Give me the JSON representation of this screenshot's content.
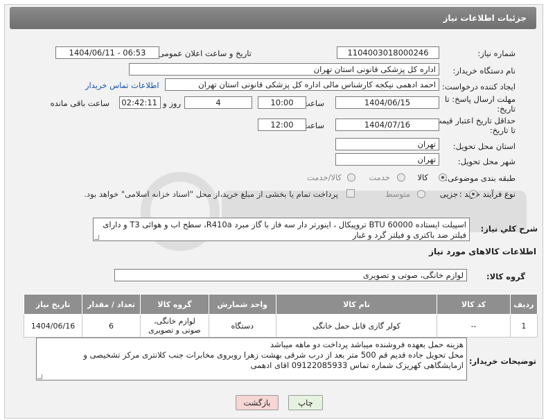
{
  "page_title": "جزئیات اطلاعات نیاز",
  "fields": {
    "need_number_label": "شماره نیاز:",
    "need_number": "1104003018000246",
    "announce_label": "تاریخ و ساعت اعلان عمومی:",
    "announce_value": "1404/06/11 - 06:53",
    "buyer_org_label": "نام دستگاه خریدار:",
    "buyer_org": "اداره کل پزشکی قانونی استان تهران",
    "creator_label": "ایجاد کننده درخواست:",
    "creator": "احمد ادهمی نیکجه کارشناس مالی اداره کل پزشکی قانونی استان تهران",
    "buyer_contact_link": "اطلاعات تماس خریدار",
    "deadline_label_1": "مهلت ارسال پاسخ: تا",
    "deadline_label_2": "تاریخ:",
    "deadline_date": "1404/06/15",
    "time_label": "ساعت",
    "deadline_time": "10:00",
    "days_value": "4",
    "days_label": "روز و",
    "remaining_time": "02:42:11",
    "remaining_label": "ساعت باقی مانده",
    "validity_label_1": "حداقل تاریخ اعتبار قیمت:",
    "validity_label_2": "تا تاریخ:",
    "validity_date": "1404/07/16",
    "validity_time_label": "ساعت",
    "validity_time": "12:00",
    "province_label": "استان محل تحویل:",
    "province": "تهران",
    "city_label": "شهر محل تحویل:",
    "city": "تهران",
    "category_label": "طبقه بندی موضوعی:",
    "category_options": [
      "کالا",
      "خدمت",
      "کالا/خدمت"
    ],
    "process_label": "نوع فرآیند خرید :",
    "process_options": [
      "جزیی",
      "متوسط"
    ],
    "payment_note": "پرداخت تمام یا بخشی از مبلغ خرید،از محل \"اسناد خزانه اسلامی\" خواهد بود."
  },
  "description": {
    "label": "شرح كلي نياز:",
    "text": "اسپیلت ایستاده BTU 60000 تروپیکال ، اینورتر دار سه فاز با گاز مبرد R410a، سطح اب و هوائی T3 و دارای فیلتر ضد باکتری و فیلتر گرد و غبار"
  },
  "goods_section_title": "اطلاعات کالاهای مورد نیاز",
  "goods_group": {
    "label": "گروه کالا:",
    "value": "لوازم خانگی، صوتی و تصویری"
  },
  "table": {
    "headers": [
      "ردیف",
      "کد کالا",
      "نام کالا",
      "واحد شمارش",
      "گروه کالا",
      "تعداد / مقدار",
      "تاریخ نیاز"
    ],
    "rows": [
      {
        "row": "1",
        "code": "--",
        "name": "کولر گازی قابل حمل خانگی",
        "unit": "دستگاه",
        "group_line1": "لوازم خانگی،",
        "group_line2": "صوتی و تصویری",
        "qty": "6",
        "date": "1404/06/16"
      }
    ]
  },
  "buyer_notes": {
    "label": "توضیحات خریدار:",
    "lines": [
      "هزینه حمل بعهده فروشنده میباشد پرداخت دو ماهه میباشد",
      "محل تحویل جاده قدیم قم 500 متر بعد از درب شرقی بهشت زهرا روبروی مخابرات جنب کلانتری مرکز تشخیصی و",
      "ازمایشگاهی کهریزک شماره تماس 09122085933 اقای ادهمی"
    ]
  },
  "buttons": {
    "print": "چاپ",
    "back": "بازگشت"
  },
  "colors": {
    "header_bar": "#7d7d7d",
    "link": "#1a56a8",
    "back_button": "#f7d6d6",
    "print_button": "#e6f2e0"
  }
}
